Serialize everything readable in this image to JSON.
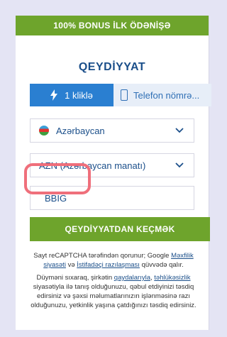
{
  "banner": {
    "text": "100% BONUS İLK ÖDƏNİŞƏ"
  },
  "form_title": "QEYDİYYAT",
  "tabs": [
    {
      "label": "1 kliklə",
      "icon": "lightning-icon",
      "active": true
    },
    {
      "label": "Telefon nömrə...",
      "icon": "phone-icon",
      "active": false
    }
  ],
  "country": {
    "value": "Azərbaycan",
    "icon": "azerbaijan-flag-icon"
  },
  "currency": {
    "value": "AZN (Azərbaycan manatı)"
  },
  "promo_code": {
    "value": "BBIG"
  },
  "register_button": "QEYDİYYATDAN KEÇMƏK",
  "recaptcha": {
    "prefix": "Sayt reCAPTCHA tərəfindən qorunur; Google ",
    "privacy_link": "Məxfilik siyasəti",
    "middle": " və ",
    "terms_link": "İstifadəçi razılaşması",
    "suffix": " qüvvədə qalır."
  },
  "terms": {
    "prefix": "Düyməni sıxaraq, şirkətin ",
    "rules_link": "qaydalarıyla",
    "middle": ", ",
    "security_link": "təhlükəsizlik",
    "suffix": " siyasətiyla ilə tanış olduğunuzu, qəbul etdiyinizi təsdiq edirsiniz və şəxsi məlumatlarınızın işlənməsinə razı olduğunuzu, yetkinlik yaşına çatdığınızı təsdiq edirsiniz."
  },
  "colors": {
    "accent_green": "#6ea42c",
    "accent_blue": "#2a7fd1",
    "title_blue": "#1b4f8a",
    "highlight": "#ef6f7b"
  }
}
